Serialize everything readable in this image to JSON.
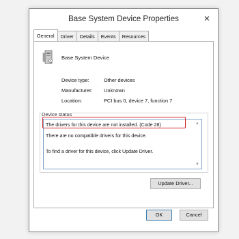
{
  "window": {
    "title": "Base System Device Properties",
    "close_glyph": "✕"
  },
  "tabs": [
    {
      "label": "General",
      "active": true
    },
    {
      "label": "Driver",
      "active": false
    },
    {
      "label": "Details",
      "active": false
    },
    {
      "label": "Events",
      "active": false
    },
    {
      "label": "Resources",
      "active": false
    }
  ],
  "device": {
    "name": "Base System Device",
    "icon": "system-device-icon",
    "properties": [
      {
        "label": "Device type:",
        "value": "Other devices"
      },
      {
        "label": "Manufacturer:",
        "value": "Unknown"
      },
      {
        "label": "Location:",
        "value": "PCI bus 0, device 7, function 7"
      }
    ]
  },
  "status": {
    "label": "Device status",
    "lines": [
      "The drivers for this device are not installed. (Code 28)",
      "There are no compatible drivers for this device.",
      "To find a driver for this device, click Update Driver."
    ],
    "highlight_color": "#d0262b"
  },
  "buttons": {
    "update_driver": "Update Driver...",
    "ok": "OK",
    "cancel": "Cancel"
  }
}
